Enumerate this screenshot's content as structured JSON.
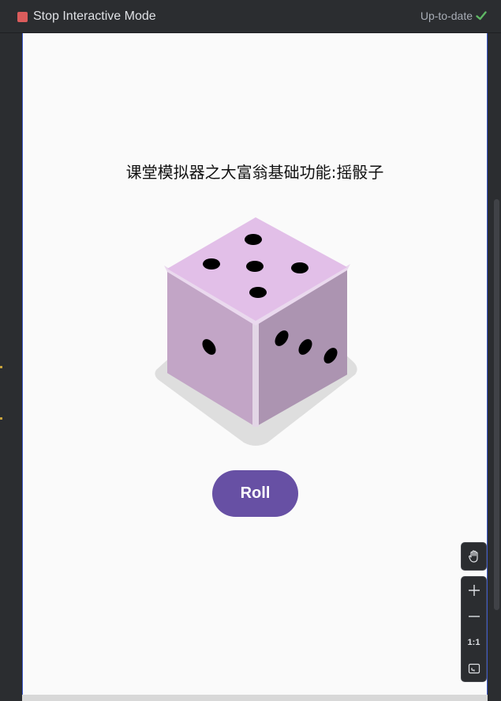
{
  "toolbar": {
    "stop_label": "Stop Interactive Mode",
    "status_label": "Up-to-date",
    "status_icon": "checkmark-icon",
    "stop_icon": "stop-square-icon"
  },
  "app": {
    "title": "课堂模拟器之大富翁基础功能:摇骰子",
    "roll_label": "Roll",
    "roll_color": "#6750a4",
    "dice": {
      "top_face": 5,
      "front_face": 1,
      "right_face": 3,
      "color_top": "#e2bfe8",
      "color_left": "#c2a5c6",
      "color_right": "#ac94b1"
    }
  },
  "zoom_controls": {
    "pan_icon": "hand-icon",
    "zoom_in_icon": "plus-icon",
    "zoom_out_icon": "minus-icon",
    "actual_size_label": "1:1",
    "fit_icon": "fit-screen-icon"
  },
  "colors": {
    "ide_background": "#2b2d30",
    "screen_background": "#fafafa",
    "stop_red": "#db5c5c",
    "status_green": "#5fb865"
  }
}
